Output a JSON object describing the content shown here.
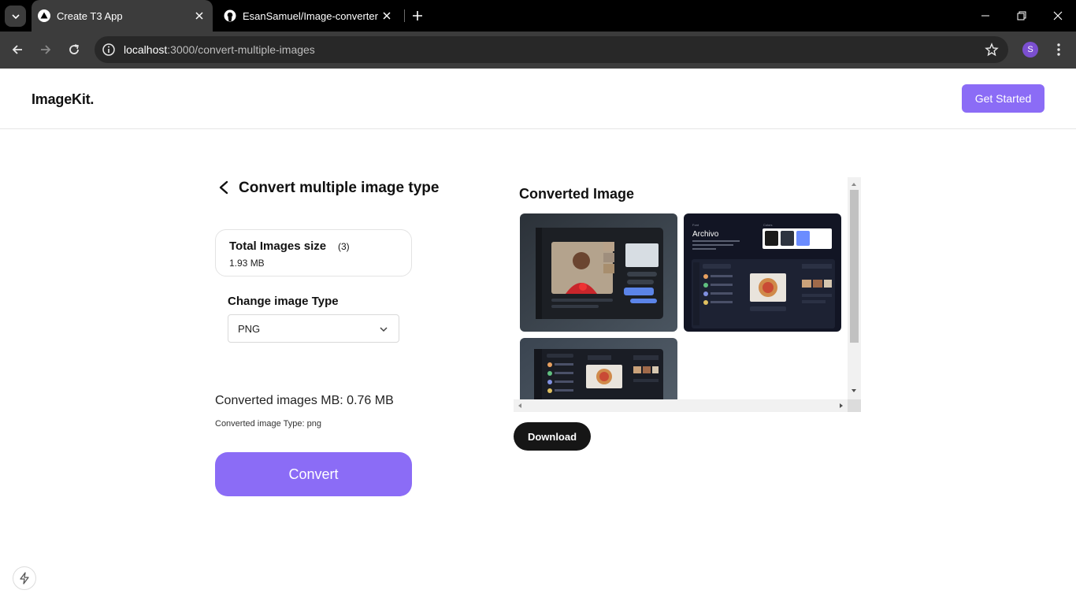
{
  "browser": {
    "tabs": [
      {
        "title": "Create T3 App",
        "active": true
      },
      {
        "title": "EsanSamuel/Image-converter",
        "active": false
      }
    ],
    "address": {
      "host": "localhost",
      "path": ":3000/convert-multiple-images"
    },
    "profile_initial": "S"
  },
  "navbar": {
    "logo": "ImageKit.",
    "cta_label": "Get Started"
  },
  "converter": {
    "title": "Convert multiple image type",
    "total_size_label": "Total Images size",
    "image_count": "(3)",
    "total_size_value": "1.93 MB",
    "change_type_label": "Change image Type",
    "selected_type": "PNG",
    "converted_mb_text": "Converted images MB: 0.76 MB",
    "converted_type_text": "Converted image Type: png",
    "convert_label": "Convert"
  },
  "preview": {
    "heading": "Converted Image",
    "download_label": "Download",
    "sample_font": "Archivo",
    "sample_colors": [
      "#1a1a1a",
      "#2e3440",
      "#6b8cff"
    ]
  },
  "colors": {
    "accent": "#8b6cf6",
    "dark_button": "#161616"
  }
}
